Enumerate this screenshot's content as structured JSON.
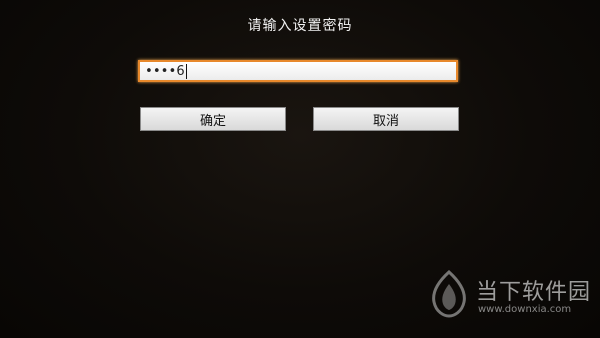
{
  "dialog": {
    "title": "请输入设置密码"
  },
  "password_field": {
    "masked_value": "••••",
    "last_char": "6",
    "border_color": "#e8892c"
  },
  "buttons": {
    "ok_label": "确定",
    "cancel_label": "取消"
  },
  "watermark": {
    "brand": "当下软件园",
    "url": "www.downxia.com",
    "logo_icon": "downxia-logo-icon"
  }
}
